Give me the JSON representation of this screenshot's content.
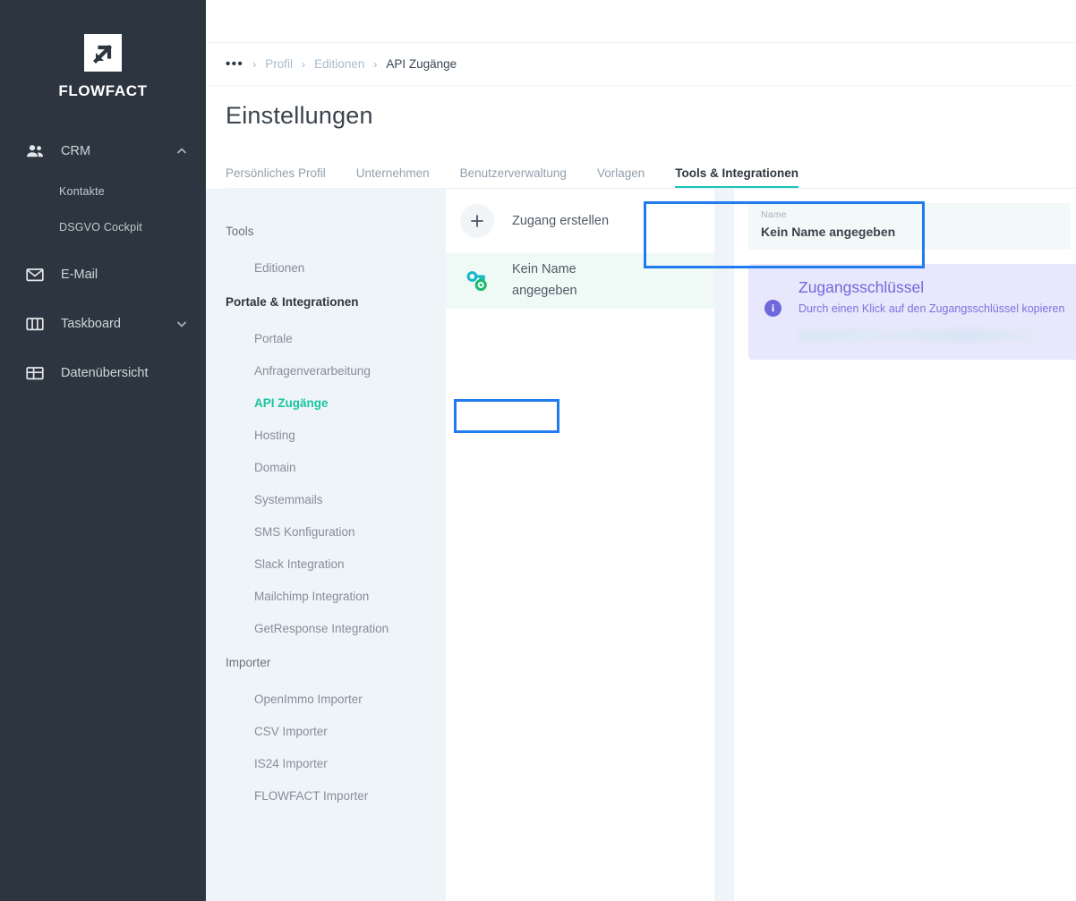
{
  "brand": {
    "name": "FLOWFACT",
    "logo_icon": "arrow-up-right-logo"
  },
  "sidebar": {
    "groups": [
      {
        "label": "CRM",
        "icon": "people-icon",
        "chevron": "chevron-up-icon",
        "expanded": true,
        "children": [
          "Kontakte",
          "DSGVO Cockpit"
        ]
      },
      {
        "label": "E-Mail",
        "icon": "envelope-icon",
        "chevron": "",
        "expanded": false,
        "children": []
      },
      {
        "label": "Taskboard",
        "icon": "columns-icon",
        "chevron": "chevron-down-icon",
        "expanded": false,
        "children": []
      },
      {
        "label": "Datenübersicht",
        "icon": "grid-icon",
        "chevron": "",
        "expanded": false,
        "children": []
      }
    ]
  },
  "breadcrumb": {
    "overflow": "•••",
    "separator": "›",
    "items": [
      "Profil",
      "Editionen"
    ],
    "current": "API Zugänge"
  },
  "header": {
    "title": "Einstellungen"
  },
  "tabs": {
    "items": [
      "Persönliches Profil",
      "Unternehmen",
      "Benutzerverwaltung",
      "Vorlagen",
      "Tools & Integrationen"
    ],
    "active": "Tools & Integrationen"
  },
  "settings_nav": {
    "sections": [
      {
        "heading": "Tools",
        "heading_bold": false,
        "items": [
          "Editionen"
        ]
      },
      {
        "heading": "Portale & Integrationen",
        "heading_bold": true,
        "items": [
          "Portale",
          "Anfragenverarbeitung",
          "API Zugänge",
          "Hosting",
          "Domain",
          "Systemmails",
          "SMS Konfiguration",
          "Slack Integration",
          "Mailchimp Integration",
          "GetResponse Integration"
        ]
      },
      {
        "heading": "Importer",
        "heading_bold": false,
        "items": [
          "OpenImmo Importer",
          "CSV Importer",
          "IS24 Importer",
          "FLOWFACT Importer"
        ]
      }
    ],
    "active": "API Zugänge"
  },
  "list_panel": {
    "create_label": "Zugang erstellen",
    "create_icon": "plus-icon",
    "items": [
      {
        "icon": "key-icon",
        "label_line1": "Kein Name",
        "label_line2": "angegeben",
        "selected": true
      }
    ]
  },
  "detail_panel": {
    "name_field": {
      "label": "Name",
      "value": "Kein Name angegeben"
    },
    "access_key_box": {
      "title": "Zugangsschlüssel",
      "info_icon": "info-icon",
      "description": "Durch einen Klick auf den Zugangsschlüssel kopieren",
      "key_value_masked": ""
    }
  },
  "annotations": {
    "highlight_color": "#1f7bef",
    "boxes": [
      "zugang-erstellen-button",
      "api-zugaenge-nav-item"
    ]
  },
  "colors": {
    "sidebar_bg": "#2d3640",
    "accent_teal": "#19c4c0",
    "accent_green": "#19c4a0",
    "purple": "#6f68dd",
    "panel_bg": "#eff4f8"
  }
}
